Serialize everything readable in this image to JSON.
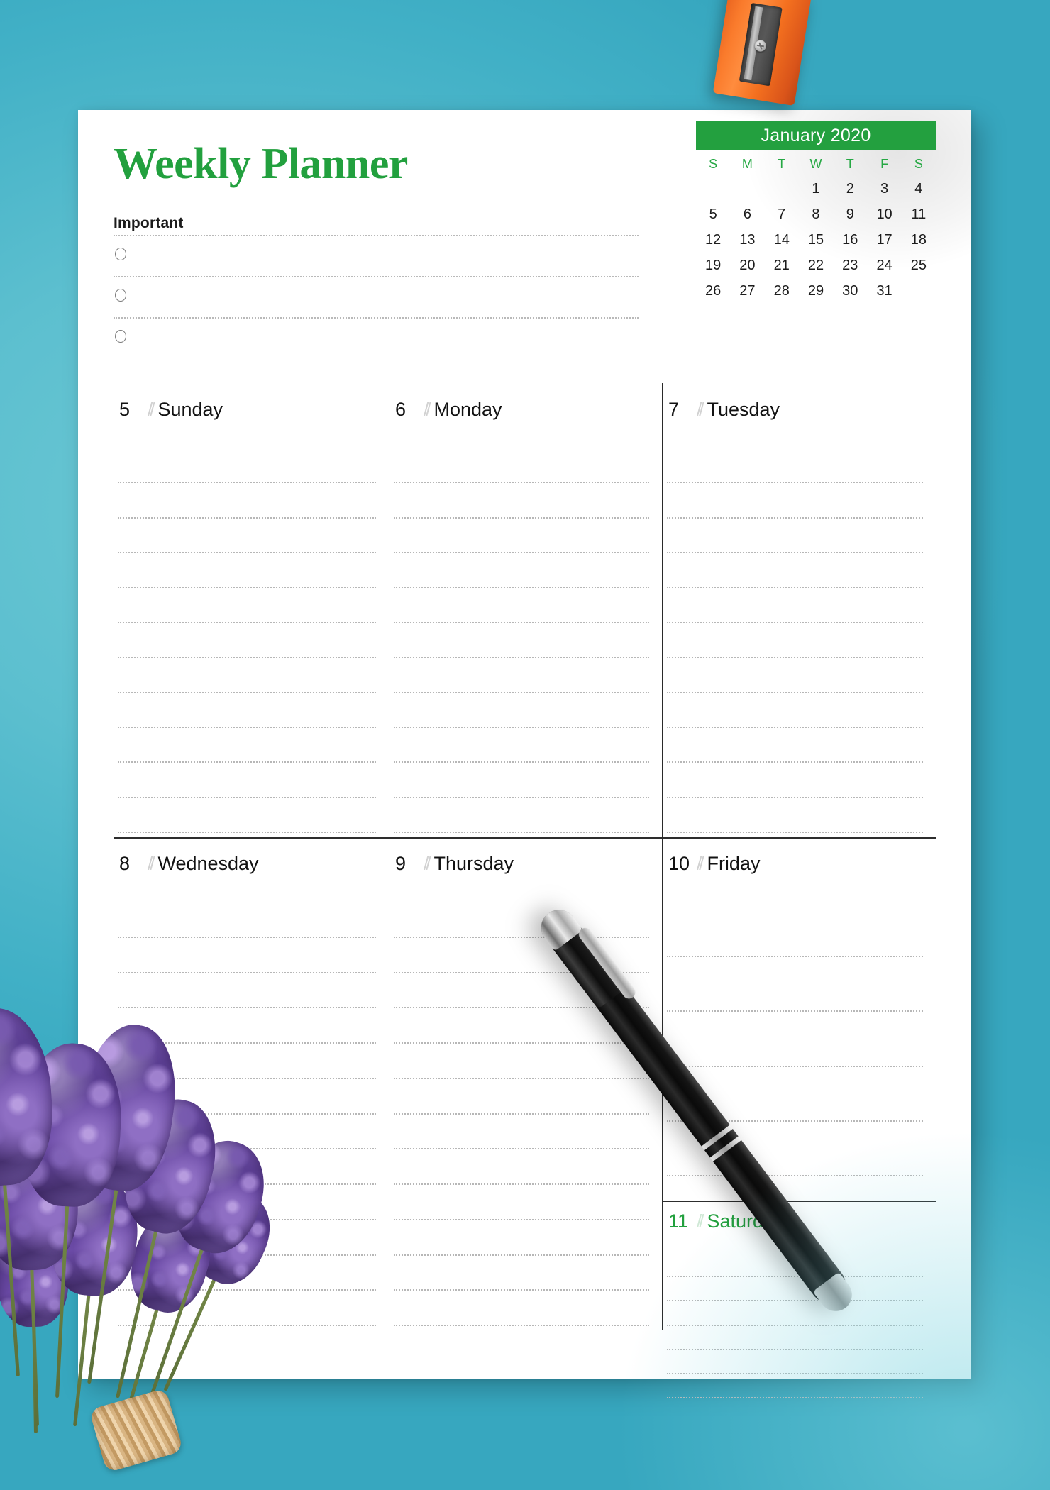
{
  "page": {
    "title": "Weekly Planner",
    "background_color": "#4cb8cc",
    "paper_color": "#ffffff",
    "accent_green": "#22a03e"
  },
  "important": {
    "label": "Important",
    "rows": 3
  },
  "mini_calendar": {
    "month_label": "January 2020",
    "header_bg": "#23a03f",
    "header_text_color": "#ffffff",
    "dow_color": "#26a844",
    "weekday_initials": [
      "S",
      "M",
      "T",
      "W",
      "T",
      "F",
      "S"
    ],
    "leading_blanks": 3,
    "days": [
      1,
      2,
      3,
      4,
      5,
      6,
      7,
      8,
      9,
      10,
      11,
      12,
      13,
      14,
      15,
      16,
      17,
      18,
      19,
      20,
      21,
      22,
      23,
      24,
      25,
      26,
      27,
      28,
      29,
      30,
      31
    ]
  },
  "week": {
    "separator": "//",
    "days": [
      {
        "date": "5",
        "name": "Sunday",
        "lines": 11,
        "highlight": false
      },
      {
        "date": "6",
        "name": "Monday",
        "lines": 11,
        "highlight": false
      },
      {
        "date": "7",
        "name": "Tuesday",
        "lines": 11,
        "highlight": false
      },
      {
        "date": "8",
        "name": "Wednesday",
        "lines": 12,
        "highlight": false
      },
      {
        "date": "9",
        "name": "Thursday",
        "lines": 12,
        "highlight": false
      },
      {
        "date": "10",
        "name": "Friday",
        "lines": 5,
        "highlight": false
      },
      {
        "date": "11",
        "name": "Saturday",
        "lines": 6,
        "highlight": true
      }
    ]
  },
  "objects": {
    "sharpener": "pencil-sharpener",
    "pen": "ballpoint-pen",
    "flowers": "lavender-bouquet"
  }
}
